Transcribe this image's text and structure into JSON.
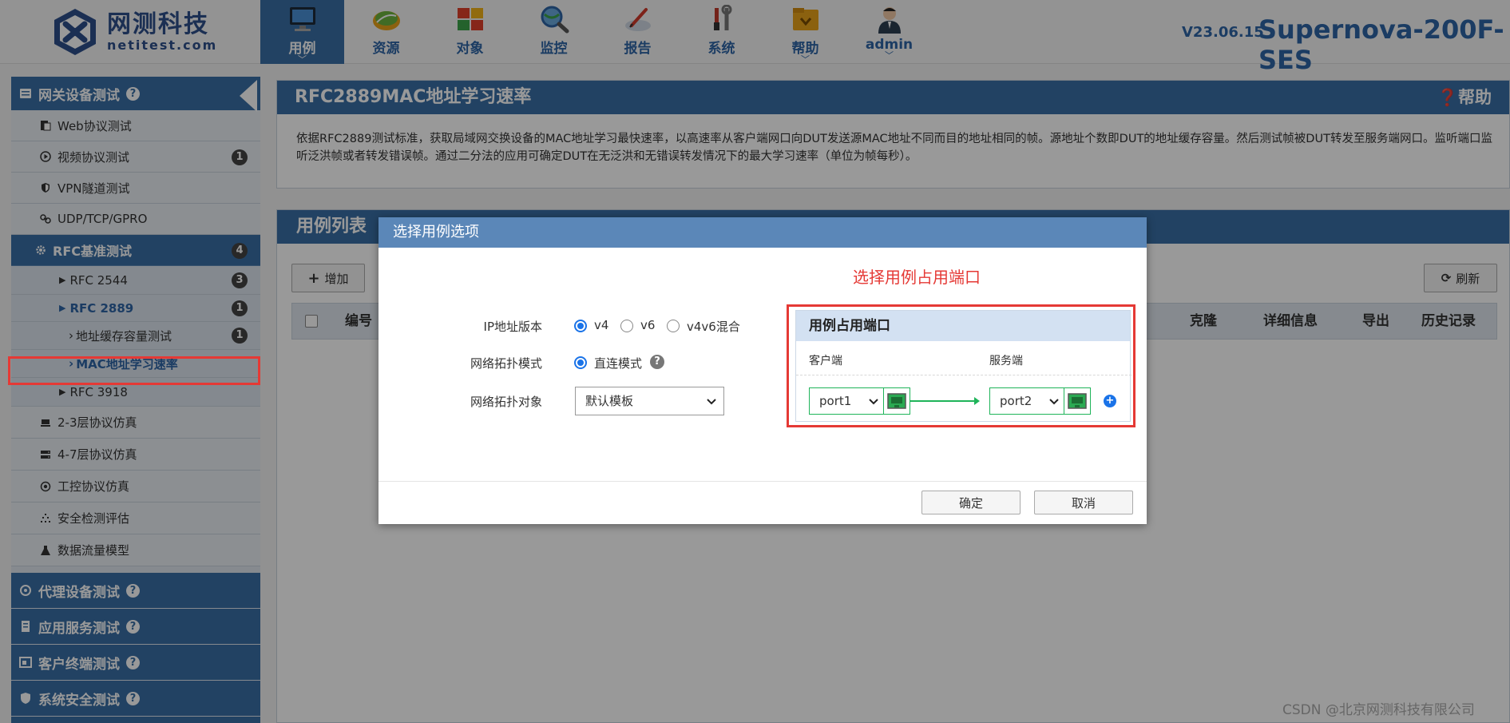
{
  "brand": {
    "name_cn": "网测科技",
    "name_en": "netitest.com"
  },
  "nav": [
    {
      "label": "用例",
      "icon": "monitor-icon",
      "active": true,
      "caret": true
    },
    {
      "label": "资源",
      "icon": "leaf-icon",
      "active": false,
      "caret": false
    },
    {
      "label": "对象",
      "icon": "blocks-icon",
      "active": false,
      "caret": false
    },
    {
      "label": "监控",
      "icon": "magnifier-globe-icon",
      "active": false,
      "caret": false
    },
    {
      "label": "报告",
      "icon": "report-pen-icon",
      "active": false,
      "caret": false
    },
    {
      "label": "系统",
      "icon": "tools-icon",
      "active": false,
      "caret": false
    },
    {
      "label": "帮助",
      "icon": "folder-help-icon",
      "active": false,
      "caret": true
    },
    {
      "label": "admin",
      "icon": "user-avatar-icon",
      "active": false,
      "caret": true
    }
  ],
  "version": "V23.06.15",
  "product": "Supernova-200F-SES",
  "sidebar": {
    "group_top": "网关设备测试",
    "items": [
      {
        "label": "Web协议测试",
        "icon": "web-doc-icon",
        "badge": ""
      },
      {
        "label": "视频协议测试",
        "icon": "play-circle-icon",
        "badge": "1"
      },
      {
        "label": "VPN隧道测试",
        "icon": "shield-icon",
        "badge": ""
      },
      {
        "label": "UDP/TCP/GPRO",
        "icon": "link-icon",
        "badge": ""
      }
    ],
    "rfc_group": {
      "label": "RFC基准测试",
      "badge": "4"
    },
    "rfc_items": [
      {
        "label": "RFC 2544",
        "badge": "3"
      },
      {
        "label": "RFC 2889",
        "badge": "1"
      }
    ],
    "rfc2889_children": [
      {
        "label": "地址缓存容量测试",
        "badge": "1"
      },
      {
        "label": "MAC地址学习速率",
        "badge": ""
      }
    ],
    "rfc_after": {
      "label": "RFC 3918"
    },
    "items2": [
      {
        "label": "2-3层协议仿真",
        "icon": "layers-icon"
      },
      {
        "label": "4-7层协议仿真",
        "icon": "server-icon"
      },
      {
        "label": "工控协议仿真",
        "icon": "target-icon"
      },
      {
        "label": "安全检测评估",
        "icon": "dots-icon"
      },
      {
        "label": "数据流量模型",
        "icon": "flask-icon"
      }
    ],
    "groups_bottom": [
      {
        "label": "代理设备测试",
        "icon": "proxy-icon"
      },
      {
        "label": "应用服务测试",
        "icon": "app-server-icon"
      },
      {
        "label": "客户终端测试",
        "icon": "terminal-icon"
      },
      {
        "label": "系统安全测试",
        "icon": "security-shield-icon"
      }
    ]
  },
  "desc": {
    "title": "RFC2889MAC地址学习速率",
    "help": "帮助",
    "text": "依据RFC2889测试标准，获取局域网交换设备的MAC地址学习最快速率，以高速率从客户端网口向DUT发送源MAC地址不同而目的地址相同的帧。源地址个数即DUT的地址缓存容量。然后测试帧被DUT转发至服务端网口。监听端口监听泛洪帧或者转发错误帧。通过二分法的应用可确定DUT在无泛洪和无错误转发情况下的最大学习速率（单位为帧每秒）。"
  },
  "list": {
    "title": "用例列表",
    "add_label": "增加",
    "refresh_label": "刷新",
    "columns": {
      "id": "编号",
      "clone": "克隆",
      "detail": "详细信息",
      "export": "导出",
      "history": "历史记录"
    }
  },
  "dialog": {
    "title": "选择用例选项",
    "ip_label": "IP地址版本",
    "ip_options": [
      "v4",
      "v6",
      "v4v6混合"
    ],
    "ip_selected": "v4",
    "topo_mode_label": "网络拓扑模式",
    "topo_mode_option": "直连模式",
    "topo_obj_label": "网络拓扑对象",
    "topo_obj_value": "默认模板",
    "annotation": "选择用例占用端口",
    "ports": {
      "title": "用例占用端口",
      "client_label": "客户端",
      "server_label": "服务端",
      "client_port": "port1",
      "server_port": "port2"
    },
    "ok_label": "确定",
    "cancel_label": "取消"
  },
  "watermark": "CSDN @北京网测科技有限公司"
}
